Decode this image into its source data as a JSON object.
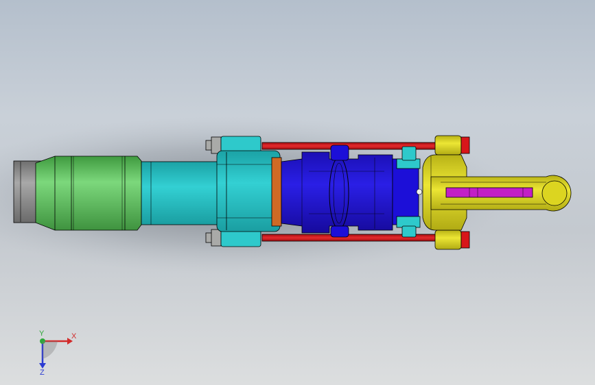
{
  "viewport": {
    "scene": "cylinder-assembly-section"
  },
  "triad": {
    "x_label": "X",
    "y_label": "Y",
    "z_label": "Z"
  },
  "colors": {
    "body_gray": "#8d8d8d",
    "coupling_green": "#5fc45f",
    "tube_cyan": "#26c3c6",
    "flange_cyan": "#2ec9cb",
    "barrel_blue": "#1c0fd8",
    "seal_orange": "#cf6a25",
    "tie_rod_red": "#d8161a",
    "end_cap_yellow": "#dcd520",
    "rod_magenta": "#c21fc6",
    "bolt_gray": "#a9aaa8",
    "x_axis": "#d22b2b",
    "y_axis": "#2fa83a",
    "z_axis": "#2b3bd2"
  }
}
